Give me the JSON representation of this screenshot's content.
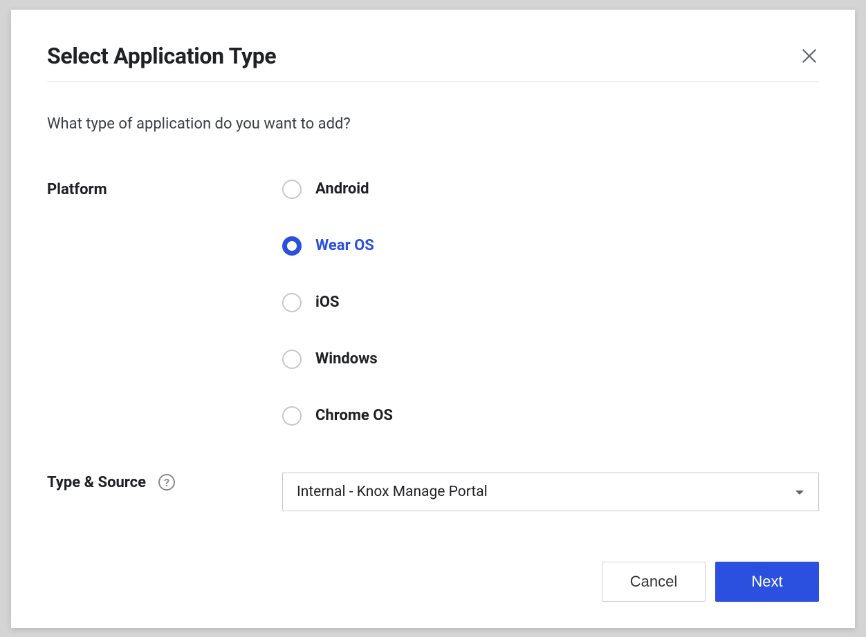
{
  "dialog": {
    "title": "Select Application Type",
    "question": "What type of application do you want to add?"
  },
  "platform": {
    "label": "Platform",
    "options": [
      {
        "label": "Android",
        "selected": false
      },
      {
        "label": "Wear OS",
        "selected": true
      },
      {
        "label": "iOS",
        "selected": false
      },
      {
        "label": "Windows",
        "selected": false
      },
      {
        "label": "Chrome OS",
        "selected": false
      }
    ]
  },
  "typeSource": {
    "label": "Type & Source",
    "selected": "Internal - Knox Manage Portal"
  },
  "footer": {
    "cancel": "Cancel",
    "next": "Next"
  }
}
